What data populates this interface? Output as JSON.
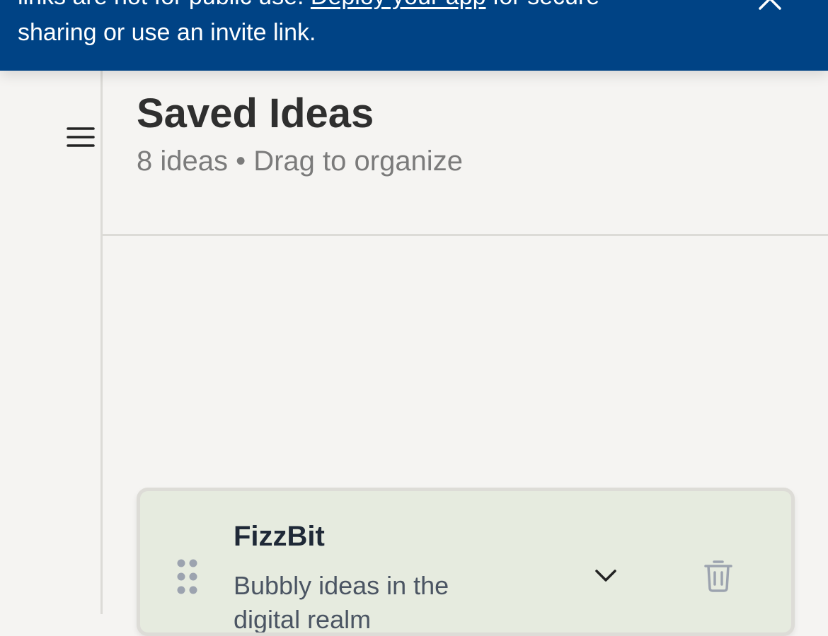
{
  "banner": {
    "text_before_link": "links are not for public use. ",
    "link_label": "Deploy your app",
    "text_after_link": " for secure",
    "line2": "sharing or use an invite link.",
    "background": "#004385",
    "close_icon": "close-icon"
  },
  "sidebar": {
    "menu_icon": "hamburger-menu-icon"
  },
  "header": {
    "title": "Saved Ideas",
    "subtitle": "8 ideas • Drag to organize"
  },
  "ideas": [
    {
      "title": "FizzBit",
      "description": "Bubbly ideas in the digital realm",
      "card_color": "#e6ebdf",
      "drag_icon": "drag-handle-icon",
      "expand_icon": "chevron-down-icon",
      "delete_icon": "trash-icon"
    }
  ]
}
